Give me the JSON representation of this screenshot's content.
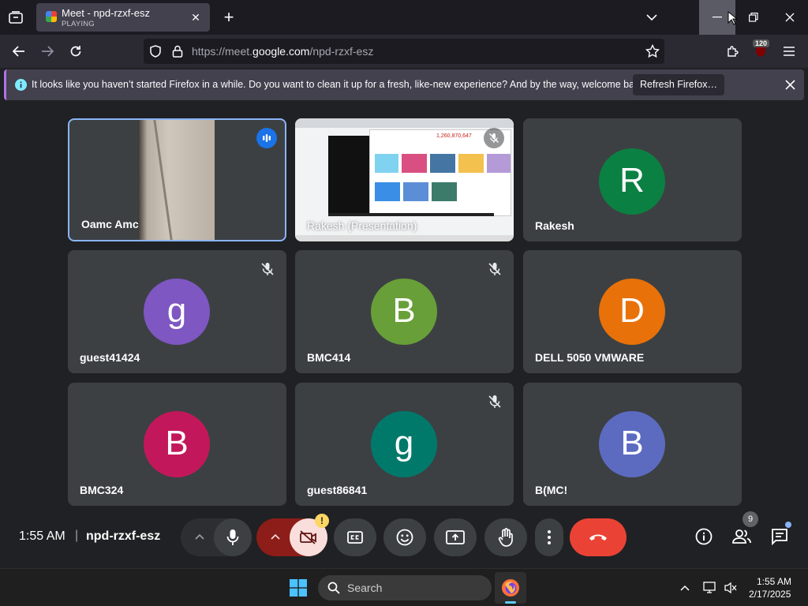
{
  "browser": {
    "tab": {
      "title": "Meet - npd-rzxf-esz",
      "subtitle": "PLAYING"
    },
    "url": {
      "prefix": "https://meet.",
      "domain": "google.com",
      "path": "/npd-rzxf-esz"
    },
    "extension_badge": "120",
    "notification": {
      "text": "It looks like you haven’t started Firefox in a while. Do you want to clean it up for a fresh, like-new experience? And by the way, welcome back!",
      "button": "Refresh Firefox…"
    }
  },
  "meet": {
    "tiles": [
      {
        "name": "Oamc Amc",
        "type": "video",
        "speaking": true
      },
      {
        "name": "Rakesh (Presentation)",
        "type": "presentation",
        "muted": true,
        "shared_screen": {
          "phone_text": "1,260,870,647"
        }
      },
      {
        "name": "Rakesh",
        "initial": "R",
        "color": "#0b8043"
      },
      {
        "name": "guest41424",
        "initial": "g",
        "color": "#7e57c2",
        "muted": true
      },
      {
        "name": "BMC414",
        "initial": "B",
        "color": "#689f38",
        "muted": true
      },
      {
        "name": "DELL 5050 VMWARE",
        "initial": "D",
        "color": "#e8710a"
      },
      {
        "name": "BMC324",
        "initial": "B",
        "color": "#c2185b"
      },
      {
        "name": "guest86841",
        "initial": "g",
        "color": "#00796b",
        "muted": true
      },
      {
        "name": "B(MC!",
        "initial": "B",
        "color": "#5c6bc0"
      }
    ],
    "footer": {
      "time": "1:55 AM",
      "separator": "|",
      "meeting_code": "npd-rzxf-esz",
      "people_count": "9",
      "warning": "!"
    },
    "colors": {
      "end_call": "#ea4335",
      "camera_off": "#f9dedc",
      "camera_caret_bg": "#8c1d18"
    }
  },
  "taskbar": {
    "search_placeholder": "Search",
    "clock_time": "1:55 AM",
    "clock_date": "2/17/2025"
  }
}
